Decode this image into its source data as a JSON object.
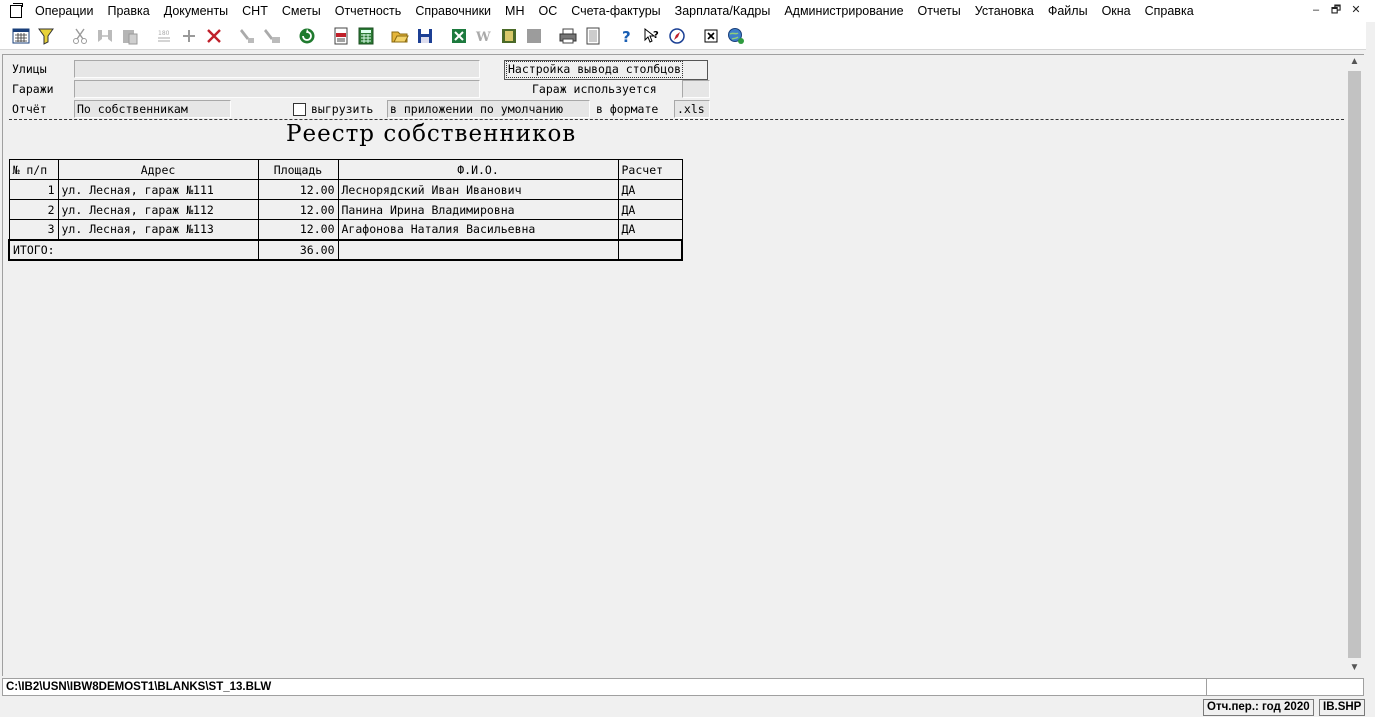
{
  "menu": {
    "items": [
      "Операции",
      "Правка",
      "Документы",
      "СНТ",
      "Сметы",
      "Отчетность",
      "Справочники",
      "МН",
      "ОС",
      "Счета-фактуры",
      "Зарплата/Кадры",
      "Администрирование",
      "Отчеты",
      "Установка",
      "Файлы",
      "Окна",
      "Справка"
    ],
    "window_controls": [
      "–",
      "🗗",
      "✕"
    ]
  },
  "toolbar": {
    "buttons": [
      "calendar-grid-icon",
      "filter-icon",
      "cut-icon",
      "copy-icon",
      "paste-icon",
      "numbering-icon",
      "add-icon",
      "delete-icon",
      "brush-icon",
      "brush-multi-icon",
      "refresh-icon",
      "pdf-document-icon",
      "calculator-icon",
      "open-folder-icon",
      "save-icon",
      "excel-icon",
      "word-icon",
      "book-icon",
      "archive-icon",
      "print-icon",
      "preview-icon",
      "help-icon",
      "context-help-icon",
      "compass-icon",
      "close-window-icon",
      "globe-icon"
    ]
  },
  "form": {
    "streets_label": "Улицы",
    "streets_value": "",
    "garages_label": "Гаражи",
    "garages_value": "",
    "report_label": "Отчёт",
    "report_value": "По собственникам",
    "columns_button": "Настройка вывода столбцов",
    "garage_used_label": "Гараж используется",
    "garage_used_value": "",
    "export_checkbox_label": "выгрузить",
    "export_app_value": "в приложении по умолчанию",
    "export_format_label": "в формате",
    "export_format_value": ".xls"
  },
  "report": {
    "title": "Реестр собственников",
    "columns": [
      "№ п/п",
      "Адрес",
      "Площадь",
      "Ф.И.О.",
      "Расчет"
    ],
    "rows": [
      {
        "num": "1",
        "address": "ул. Лесная, гараж №111",
        "area": "12.00",
        "name": "Леснорядский Иван Иванович",
        "calc": "ДА"
      },
      {
        "num": "2",
        "address": "ул. Лесная, гараж №112",
        "area": "12.00",
        "name": "Панина Ирина Владимировна",
        "calc": "ДА"
      },
      {
        "num": "3",
        "address": "ул. Лесная, гараж №113",
        "area": "12.00",
        "name": "Агафонова Наталия Васильевна",
        "calc": "ДА"
      }
    ],
    "total_label": "ИТОГО:",
    "total_area": "36.00"
  },
  "path": "C:\\IB2\\USN\\IBW8DEMOST1\\BLANKS\\ST_13.BLW",
  "status": {
    "period": "Отч.пер.: год 2020",
    "module": "IB.SHP"
  }
}
